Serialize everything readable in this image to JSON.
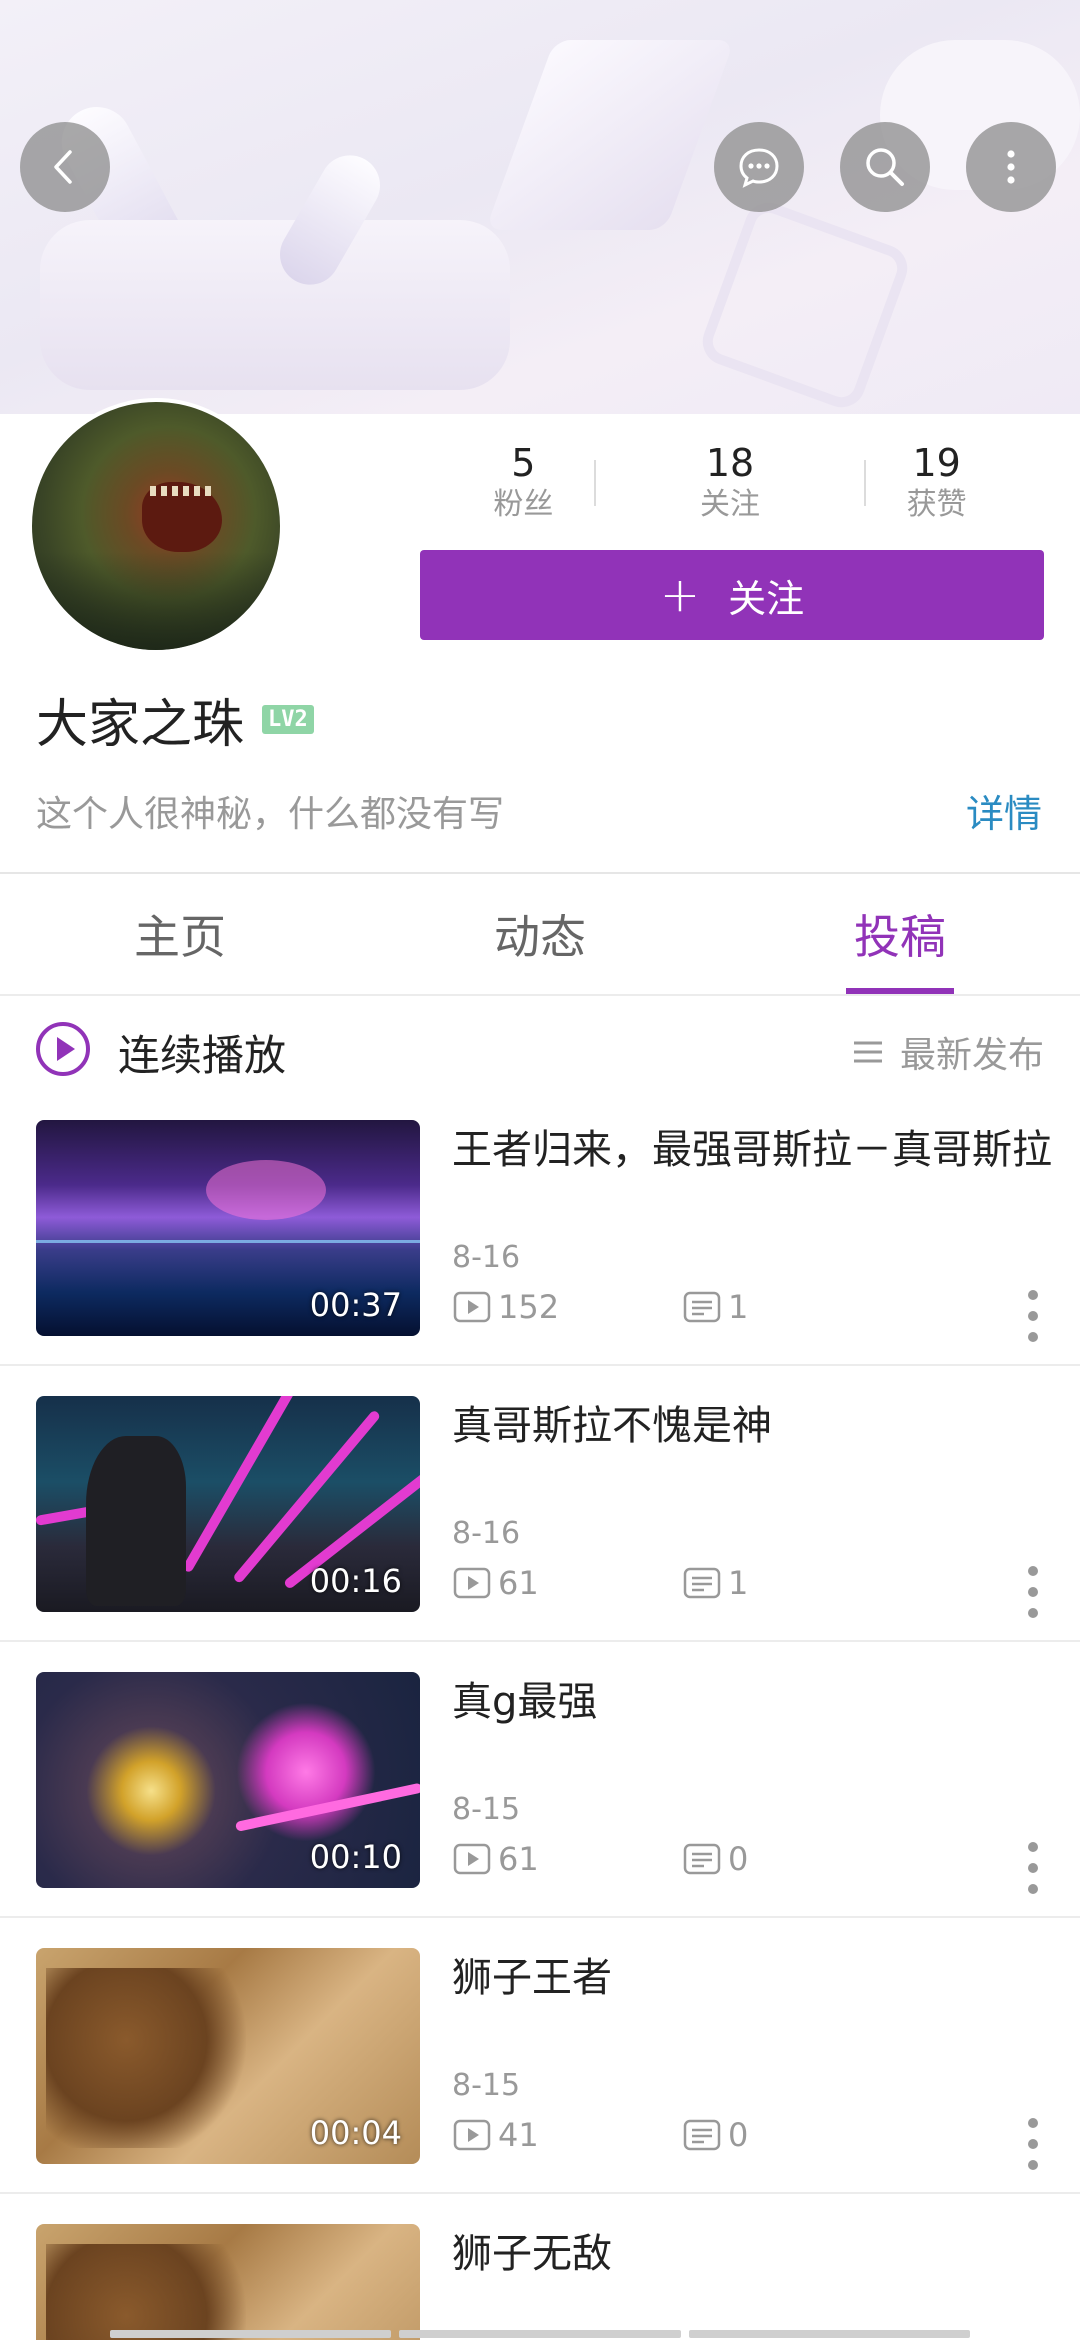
{
  "header": {
    "back_icon": "chevron-left-icon",
    "chat_icon": "chat-bubble-icon",
    "search_icon": "search-icon",
    "more_icon": "more-vertical-icon"
  },
  "profile": {
    "stats": [
      {
        "value": "5",
        "label": "粉丝"
      },
      {
        "value": "18",
        "label": "关注"
      },
      {
        "value": "19",
        "label": "获赞"
      }
    ],
    "follow_plus": "+",
    "follow_label": "关注",
    "username": "大家之珠",
    "level": "LV2",
    "bio": "这个人很神秘，什么都没有写",
    "detail_link": "详情"
  },
  "tabs": [
    {
      "label": "主页",
      "active": false
    },
    {
      "label": "动态",
      "active": false
    },
    {
      "label": "投稿",
      "active": true
    }
  ],
  "list_header": {
    "play_label": "连续播放",
    "sort_label": "最新发布"
  },
  "videos": [
    {
      "title": "王者归来，最强哥斯拉－真哥斯拉",
      "date": "8-16",
      "duration": "00:37",
      "views": "152",
      "comments": "1"
    },
    {
      "title": "真哥斯拉不愧是神",
      "date": "8-16",
      "duration": "00:16",
      "views": "61",
      "comments": "1"
    },
    {
      "title": "真g最强",
      "date": "8-15",
      "duration": "00:10",
      "views": "61",
      "comments": "0"
    },
    {
      "title": "狮子王者",
      "date": "8-15",
      "duration": "00:04",
      "views": "41",
      "comments": "0"
    },
    {
      "title": "狮子无敌"
    }
  ],
  "colors": {
    "accent": "#9133b8",
    "link": "#2a8bc2",
    "muted": "#999999"
  }
}
